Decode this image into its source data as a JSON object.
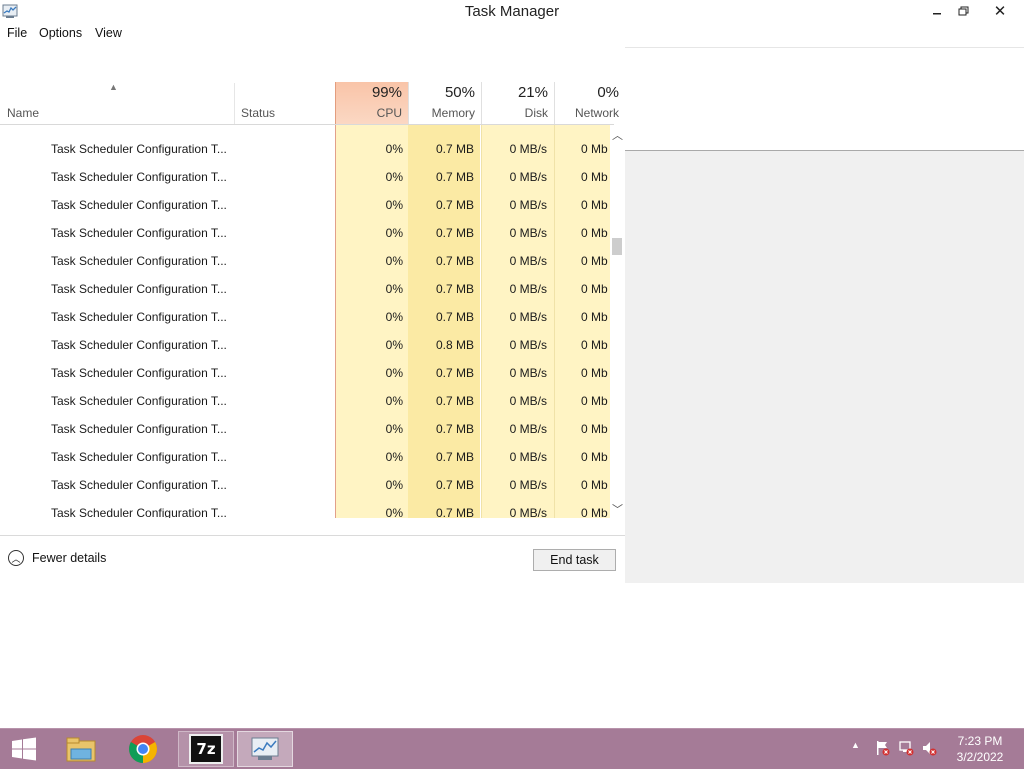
{
  "window": {
    "title": "Task Manager",
    "icon": "task-manager-icon",
    "controls": [
      "minimize-icon",
      "restore-icon",
      "close-icon"
    ]
  },
  "menu": {
    "file": "File",
    "options": "Options",
    "view": "View"
  },
  "columns": {
    "name": "Name",
    "status": "Status",
    "cpu": {
      "pct": "99%",
      "label": "CPU"
    },
    "memory": {
      "pct": "50%",
      "label": "Memory"
    },
    "disk": {
      "pct": "21%",
      "label": "Disk"
    },
    "network": {
      "pct": "0%",
      "label": "Network"
    }
  },
  "rows": [
    {
      "name": "Task Scheduler Configuration T...",
      "cpu": "0%",
      "memory": "0.7 MB",
      "disk": "0 MB/s",
      "network": "0 Mb"
    },
    {
      "name": "Task Scheduler Configuration T...",
      "cpu": "0%",
      "memory": "0.7 MB",
      "disk": "0 MB/s",
      "network": "0 Mb"
    },
    {
      "name": "Task Scheduler Configuration T...",
      "cpu": "0%",
      "memory": "0.7 MB",
      "disk": "0 MB/s",
      "network": "0 Mb"
    },
    {
      "name": "Task Scheduler Configuration T...",
      "cpu": "0%",
      "memory": "0.7 MB",
      "disk": "0 MB/s",
      "network": "0 Mb"
    },
    {
      "name": "Task Scheduler Configuration T...",
      "cpu": "0%",
      "memory": "0.7 MB",
      "disk": "0 MB/s",
      "network": "0 Mb"
    },
    {
      "name": "Task Scheduler Configuration T...",
      "cpu": "0%",
      "memory": "0.7 MB",
      "disk": "0 MB/s",
      "network": "0 Mb"
    },
    {
      "name": "Task Scheduler Configuration T...",
      "cpu": "0%",
      "memory": "0.7 MB",
      "disk": "0 MB/s",
      "network": "0 Mb"
    },
    {
      "name": "Task Scheduler Configuration T...",
      "cpu": "0%",
      "memory": "0.8 MB",
      "disk": "0 MB/s",
      "network": "0 Mb"
    },
    {
      "name": "Task Scheduler Configuration T...",
      "cpu": "0%",
      "memory": "0.7 MB",
      "disk": "0 MB/s",
      "network": "0 Mb"
    },
    {
      "name": "Task Scheduler Configuration T...",
      "cpu": "0%",
      "memory": "0.7 MB",
      "disk": "0 MB/s",
      "network": "0 Mb"
    },
    {
      "name": "Task Scheduler Configuration T...",
      "cpu": "0%",
      "memory": "0.7 MB",
      "disk": "0 MB/s",
      "network": "0 Mb"
    },
    {
      "name": "Task Scheduler Configuration T...",
      "cpu": "0%",
      "memory": "0.7 MB",
      "disk": "0 MB/s",
      "network": "0 Mb"
    },
    {
      "name": "Task Scheduler Configuration T...",
      "cpu": "0%",
      "memory": "0.7 MB",
      "disk": "0 MB/s",
      "network": "0 Mb"
    },
    {
      "name": "Task Scheduler Configuration T...",
      "cpu": "0%",
      "memory": "0.7 MB",
      "disk": "0 MB/s",
      "network": "0 Mb"
    }
  ],
  "footer": {
    "fewer_details": "Fewer details",
    "end_task": "End task"
  },
  "taskbar": {
    "items": [
      "windows-start-icon",
      "file-explorer-icon",
      "chrome-icon",
      "7zip-icon",
      "task-manager-icon"
    ],
    "7zip_label": "7z",
    "clock_time": "7:23 PM",
    "clock_date": "3/2/2022",
    "colors": {
      "taskbar": "#a57b97"
    }
  },
  "accent": {
    "cpu_header": "#f9c4a8",
    "cell_highlight": "#fff4c4"
  }
}
